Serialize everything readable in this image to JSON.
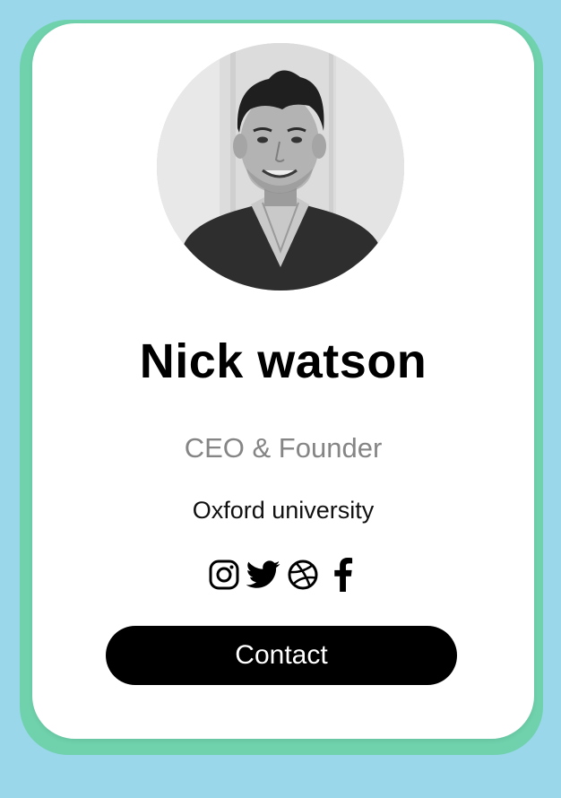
{
  "profile": {
    "name": "Nick watson",
    "role": "CEO & Founder",
    "organization": "Oxford university",
    "avatar_description_icon": "profile-photo"
  },
  "socials": [
    {
      "icon": "instagram-icon"
    },
    {
      "icon": "twitter-icon"
    },
    {
      "icon": "dribbble-icon"
    },
    {
      "icon": "facebook-icon"
    }
  ],
  "actions": {
    "contact_label": "Contact"
  },
  "colors": {
    "background": "#9ad7ea",
    "card_border": "#6fd2ad",
    "card": "#ffffff",
    "button": "#000000",
    "button_text": "#ffffff",
    "role_text": "#858585"
  }
}
